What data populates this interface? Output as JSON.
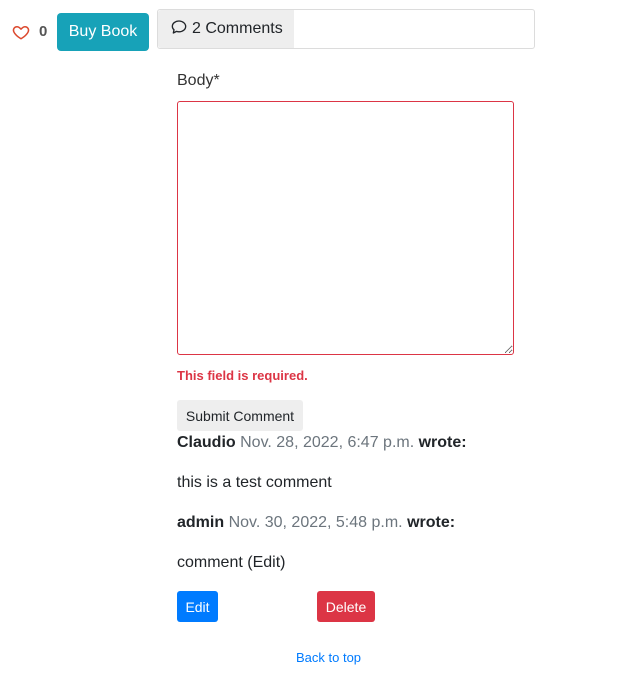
{
  "toolbar": {
    "like_count": "0",
    "buy_label": "Buy Book",
    "comments_label": "2 Comments"
  },
  "form": {
    "body_label": "Body*",
    "body_value": "",
    "error": "This field is required.",
    "submit_label": "Submit Comment"
  },
  "comments": [
    {
      "author": "Claudio",
      "date": "Nov. 28, 2022, 6:47 p.m.",
      "wrote": "wrote:",
      "body": "this is a test comment"
    },
    {
      "author": "admin",
      "date": "Nov. 30, 2022, 5:48 p.m.",
      "wrote": "wrote:",
      "body": "comment (Edit)"
    }
  ],
  "actions": {
    "edit_label": "Edit",
    "delete_label": "Delete"
  },
  "footer": {
    "back_to_top": "Back to top"
  },
  "icons": {
    "like": "heart-outline-icon",
    "comments": "chat-bubble-icon"
  },
  "colors": {
    "heart": "#dc4a2f",
    "buy": "#17a2b8",
    "error": "#dc3545",
    "edit": "#007bff",
    "delete": "#dc3545",
    "link": "#007bff"
  }
}
